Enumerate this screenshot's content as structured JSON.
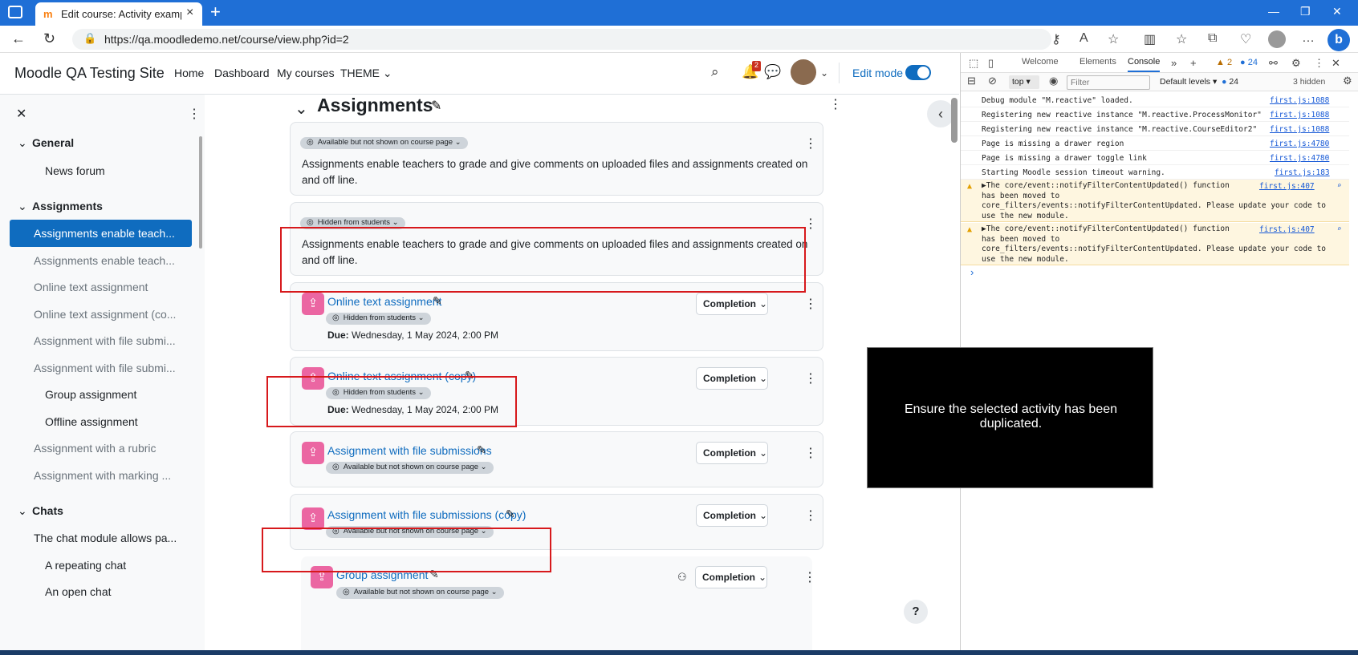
{
  "browser": {
    "tab_title": "Edit course: Activity examples | M",
    "tab_favicon": "moodle-icon",
    "url": "https://qa.moodledemo.net/course/view.php?id=2"
  },
  "navbar": {
    "site_name": "Moodle QA Testing Site",
    "links": [
      "Home",
      "Dashboard",
      "My courses",
      "THEME"
    ],
    "notification_count": "2",
    "edit_mode_label": "Edit mode"
  },
  "course_index": {
    "sections": [
      {
        "title": "General",
        "items": [
          "News forum"
        ]
      },
      {
        "title": "Assignments",
        "items": [
          "Assignments enable teach...",
          "Assignments enable teach...",
          "Online text assignment",
          "Online text assignment (co...",
          "Assignment with file submi...",
          "Assignment with file submi...",
          "Group assignment",
          "Offline assignment",
          "Assignment with a rubric",
          "Assignment with marking ..."
        ]
      },
      {
        "title": "Chats",
        "items": [
          "The chat module allows pa...",
          "A repeating chat",
          "An open chat"
        ]
      }
    ]
  },
  "main": {
    "section_title": "Assignments",
    "cards": [
      {
        "badge": "Available but not shown on course page",
        "text": "Assignments enable teachers to grade and give comments on uploaded files and assignments created on and off line."
      },
      {
        "badge": "Hidden from students",
        "text": "Assignments enable teachers to grade and give comments on uploaded files and assignments created on and off line."
      }
    ],
    "activities": [
      {
        "name": "Online text assignment",
        "badge": "Hidden from students",
        "due_label": "Due:",
        "due": "Wednesday, 1 May 2024, 2:00 PM",
        "completion": "Completion"
      },
      {
        "name": "Online text assignment (copy)",
        "badge": "Hidden from students",
        "due_label": "Due:",
        "due": "Wednesday, 1 May 2024, 2:00 PM",
        "completion": "Completion"
      },
      {
        "name": "Assignment with file submissions",
        "badge": "Available but not shown on course page",
        "completion": "Completion"
      },
      {
        "name": "Assignment with file submissions (copy)",
        "badge": "Available but not shown on course page",
        "completion": "Completion"
      },
      {
        "name": "Group assignment",
        "badge": "Available but not shown on course page",
        "completion": "Completion"
      }
    ]
  },
  "devtools": {
    "tabs": [
      "Welcome",
      "Elements",
      "Console"
    ],
    "warnings": "2",
    "infos": "24",
    "context": "top",
    "filter_placeholder": "Filter",
    "levels": "Default levels",
    "levels_count": "24",
    "hidden": "3 hidden",
    "logs": [
      {
        "msg": "Debug module \"M.reactive\" loaded.",
        "src": "first.js:1088"
      },
      {
        "msg": "Registering new reactive instance \"M.reactive.ProcessMonitor\"",
        "src": "first.js:1088"
      },
      {
        "msg": "Registering new reactive instance \"M.reactive.CourseEditor2\"",
        "src": "first.js:1088"
      },
      {
        "msg": "Page is missing a drawer region",
        "src": "first.js:4780"
      },
      {
        "msg": "Page is missing a drawer toggle link",
        "src": "first.js:4780"
      },
      {
        "msg": "Starting Moodle session timeout warning.",
        "src": "first.js:183"
      }
    ],
    "warning_logs": [
      {
        "msg": "▶The core/event::notifyFilterContentUpdated() function\nhas been moved to\ncore_filters/events::notifyFilterContentUpdated. Please update your code to\nuse the new module.",
        "src": "first.js:407"
      },
      {
        "msg": "▶The core/event::notifyFilterContentUpdated() function\nhas been moved to\ncore_filters/events::notifyFilterContentUpdated. Please update your code to\nuse the new module.",
        "src": "first.js:407"
      }
    ]
  },
  "overlay": {
    "text": "Ensure the selected activity has been duplicated."
  }
}
